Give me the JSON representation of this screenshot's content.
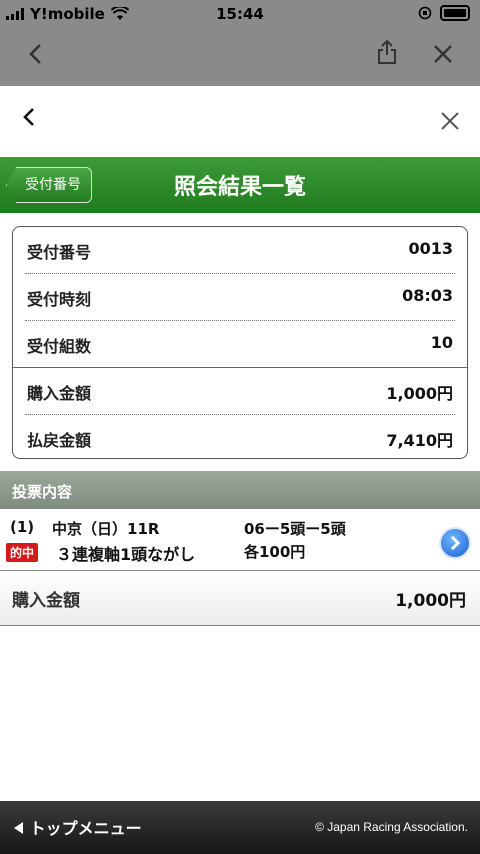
{
  "status_bar": {
    "carrier": "Y!mobile",
    "time": "15:44"
  },
  "browser_bar": {
    "back_icon": "chevron-left-icon",
    "share_icon": "share-icon",
    "close_icon": "close-icon"
  },
  "page_header": {
    "back_icon": "chevron-left-icon",
    "close_icon": "close-icon"
  },
  "title_bar": {
    "back_button_label": "受付番号",
    "title": "照会結果一覧"
  },
  "summary": {
    "rows": [
      {
        "label": "受付番号",
        "value": "0013"
      },
      {
        "label": "受付時刻",
        "value": "08:03"
      },
      {
        "label": "受付組数",
        "value": "10"
      },
      {
        "label": "購入金額",
        "value": "1,000円"
      },
      {
        "label": "払戻金額",
        "value": "7,410円"
      }
    ]
  },
  "bets_section": {
    "header": "投票内容",
    "items": [
      {
        "number": "(1)",
        "race": "中京（日）11R",
        "combination": "06ー5頭ー5頭",
        "result_badge": "的中",
        "bet_type": "３連複軸1頭ながし",
        "amount": "各100円"
      }
    ]
  },
  "total": {
    "label": "購入金額",
    "value": "1,000円"
  },
  "footer": {
    "menu_label": "トップメニュー",
    "copyright": "© Japan Racing Association."
  },
  "colors": {
    "title_bar_green": "#2d8a29",
    "badge_red": "#d41a1a",
    "footer_dark": "#222222"
  }
}
